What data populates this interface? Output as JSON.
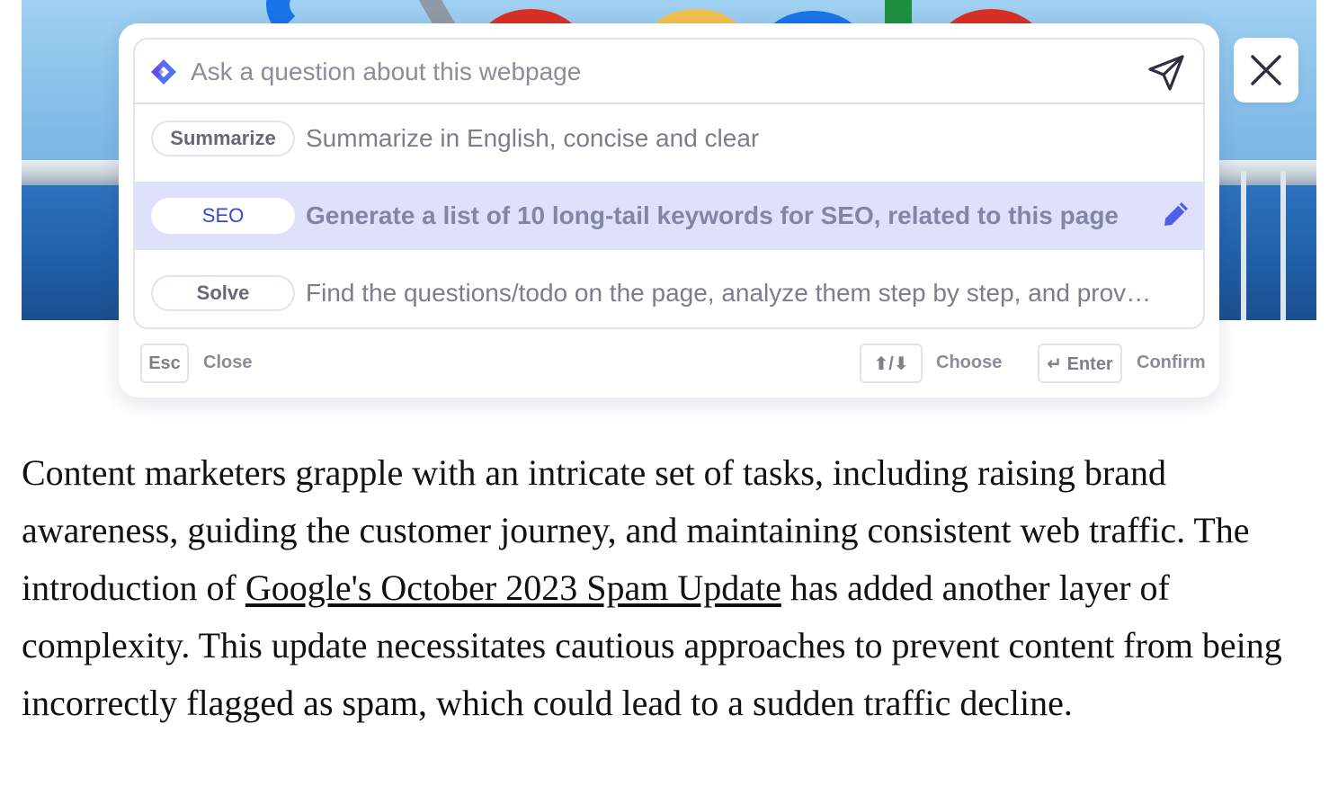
{
  "assistant": {
    "ask_placeholder": "Ask a question about this webpage",
    "prompts": [
      {
        "tag": "Summarize",
        "text": "Summarize in English, concise and clear"
      },
      {
        "tag": "SEO",
        "text": "Generate a list of 10 long-tail keywords for SEO, related to this page",
        "selected": true
      },
      {
        "tag": "Solve",
        "text": "Find the questions/todo on the page, analyze them step by step, and prov…"
      }
    ],
    "footer": {
      "esc_key": "Esc",
      "esc_label": "Close",
      "arrows_key": "⬆/⬇",
      "arrows_label": "Choose",
      "enter_key": "↵ Enter",
      "enter_label": "Confirm"
    },
    "icons": {
      "brand": "assistant-logo-icon",
      "send": "send-icon",
      "edit": "pencil-icon",
      "close": "close-icon"
    },
    "colors": {
      "accent": "#3946d6",
      "selected_row": "#dfe1fb",
      "pencil": "#4f5ee8"
    }
  },
  "article": {
    "p1_before_link": "Content marketers grapple with an intricate set of tasks, including raising brand awareness, guiding the customer journey, and maintaining consistent web traffic. The introduction of ",
    "link_text": "Google's October 2023 Spam Update",
    "p1_after_link": " has added another layer of complexity. This update necessitates cautious approaches to prevent content from being incorrectly flagged as spam, which could lead to a sudden traffic decline."
  }
}
